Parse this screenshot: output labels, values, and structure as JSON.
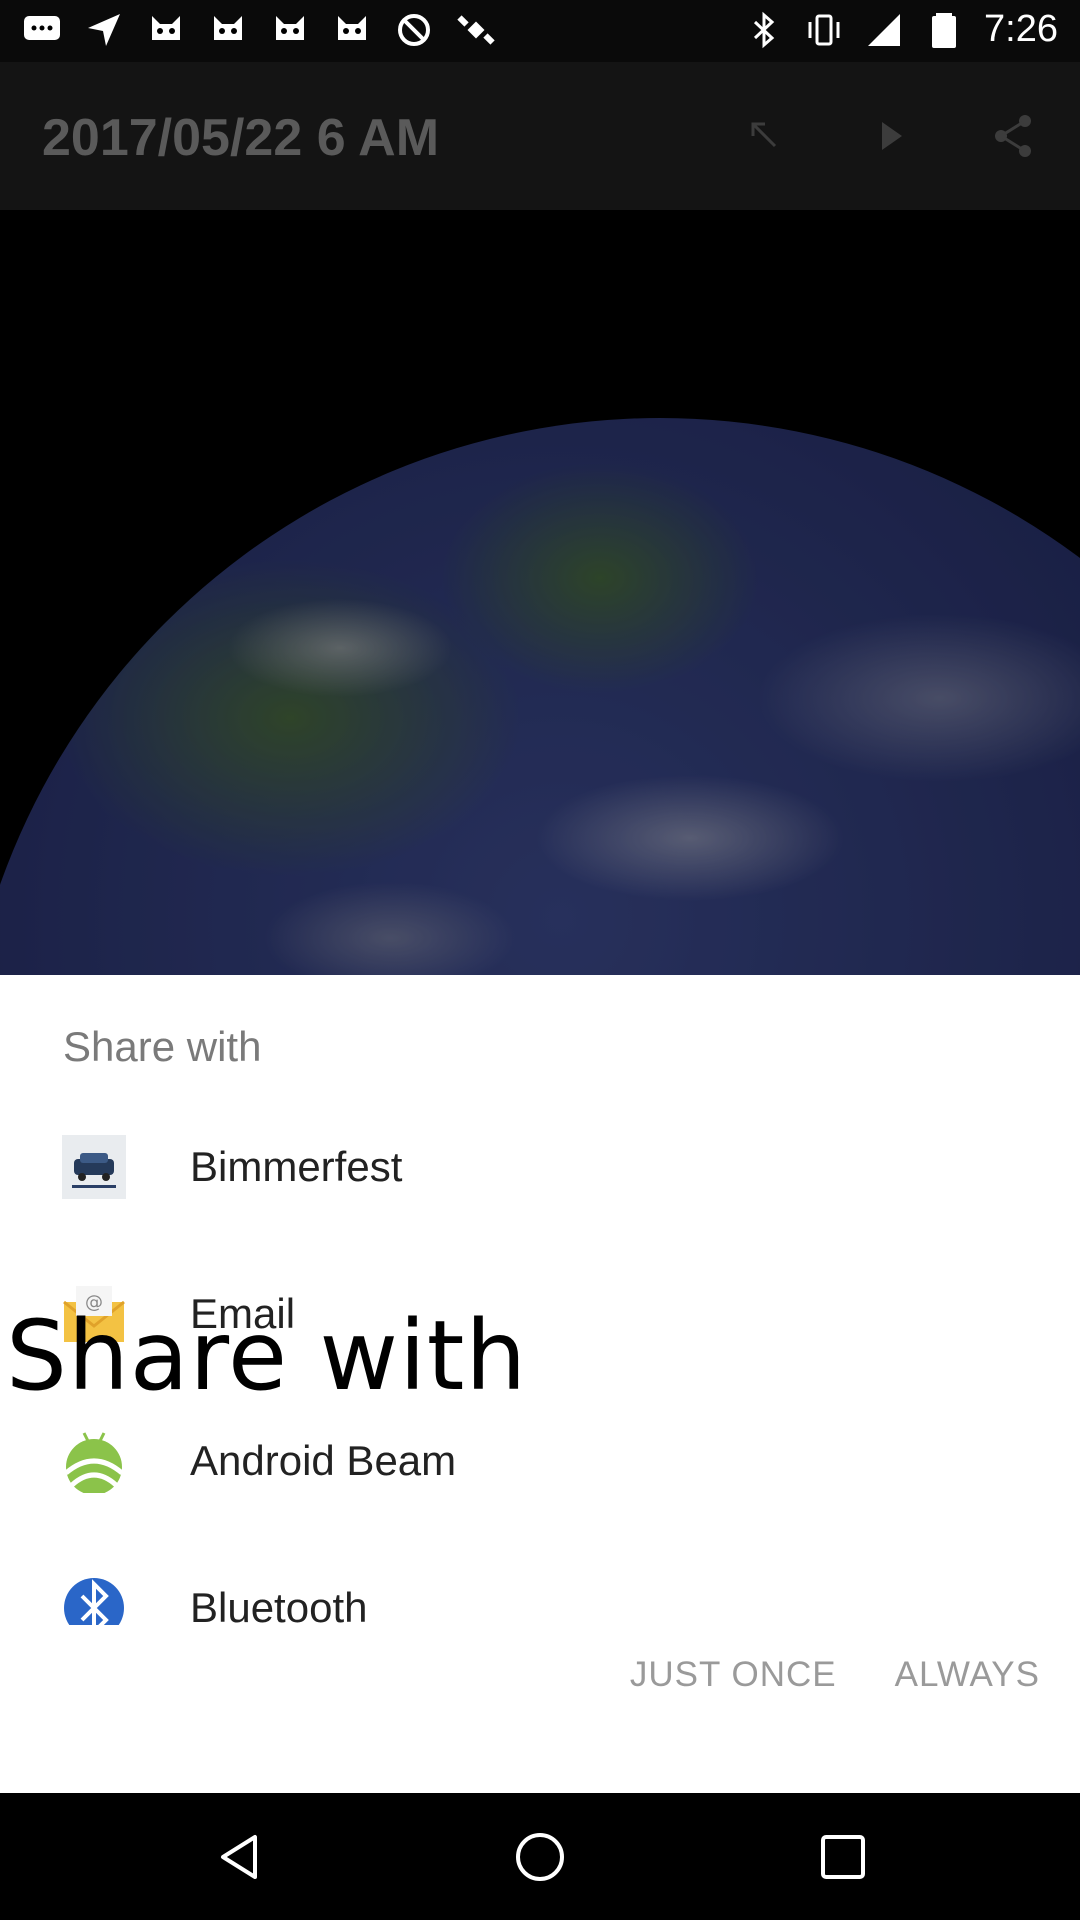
{
  "status_bar": {
    "time": "7:26",
    "left_icons": [
      "chat-icon",
      "navigation-icon",
      "cat-icon",
      "cat-icon",
      "cat-icon",
      "cat-icon",
      "blocked-icon",
      "satellite-icon"
    ],
    "right_icons": [
      "bluetooth-icon",
      "vibrate-icon",
      "signal-icon",
      "battery-icon"
    ]
  },
  "toolbar": {
    "title": "2017/05/22 6 AM"
  },
  "share_sheet": {
    "title": "Share with",
    "items": [
      {
        "label": "Bimmerfest",
        "icon": "bimmerfest-icon"
      },
      {
        "label": "Email",
        "icon": "email-icon"
      },
      {
        "label": "Android Beam",
        "icon": "android-beam-icon"
      },
      {
        "label": "Bluetooth",
        "icon": "bluetooth-app-icon"
      }
    ],
    "just_once": "JUST ONCE",
    "always": "ALWAYS"
  },
  "overlay_caption": "Share with",
  "colors": {
    "sheet_background": "#ffffff",
    "button_text": "#9a9a9a",
    "title_text": "#7a7a7a"
  }
}
